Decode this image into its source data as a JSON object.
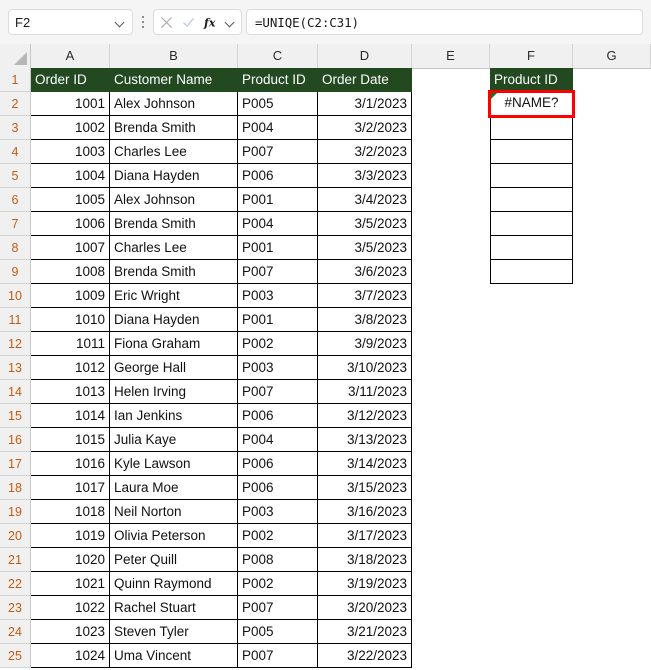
{
  "formula_bar": {
    "name_box_value": "F2",
    "formula_value": "=UNIQE(C2:C31)",
    "cancel_icon": "close-icon",
    "confirm_icon": "check-icon",
    "function_icon": "fx-icon",
    "dropdown_icon": "chevron-down-icon"
  },
  "grid": {
    "column_headers": [
      "A",
      "B",
      "C",
      "D",
      "E",
      "F",
      "G"
    ],
    "row_numbers": [
      1,
      2,
      3,
      4,
      5,
      6,
      7,
      8,
      9,
      10,
      11,
      12,
      13,
      14,
      15,
      16,
      17,
      18,
      19,
      20,
      21,
      22,
      23,
      24,
      25
    ],
    "table_headers": {
      "A1": "Order ID",
      "B1": "Customer Name",
      "C1": "Product ID",
      "D1": "Order Date",
      "F1": "Product ID"
    },
    "rows": [
      {
        "row": 2,
        "order_id": "1001",
        "customer": "Alex Johnson",
        "product_id": "P005",
        "order_date": "3/1/2023"
      },
      {
        "row": 3,
        "order_id": "1002",
        "customer": "Brenda Smith",
        "product_id": "P004",
        "order_date": "3/2/2023"
      },
      {
        "row": 4,
        "order_id": "1003",
        "customer": "Charles Lee",
        "product_id": "P007",
        "order_date": "3/2/2023"
      },
      {
        "row": 5,
        "order_id": "1004",
        "customer": "Diana Hayden",
        "product_id": "P006",
        "order_date": "3/3/2023"
      },
      {
        "row": 6,
        "order_id": "1005",
        "customer": "Alex Johnson",
        "product_id": "P001",
        "order_date": "3/4/2023"
      },
      {
        "row": 7,
        "order_id": "1006",
        "customer": "Brenda Smith",
        "product_id": "P004",
        "order_date": "3/5/2023"
      },
      {
        "row": 8,
        "order_id": "1007",
        "customer": "Charles Lee",
        "product_id": "P001",
        "order_date": "3/5/2023"
      },
      {
        "row": 9,
        "order_id": "1008",
        "customer": "Brenda Smith",
        "product_id": "P007",
        "order_date": "3/6/2023"
      },
      {
        "row": 10,
        "order_id": "1009",
        "customer": "Eric Wright",
        "product_id": "P003",
        "order_date": "3/7/2023"
      },
      {
        "row": 11,
        "order_id": "1010",
        "customer": "Diana Hayden",
        "product_id": "P001",
        "order_date": "3/8/2023"
      },
      {
        "row": 12,
        "order_id": "1011",
        "customer": "Fiona Graham",
        "product_id": "P002",
        "order_date": "3/9/2023"
      },
      {
        "row": 13,
        "order_id": "1012",
        "customer": "George Hall",
        "product_id": "P003",
        "order_date": "3/10/2023"
      },
      {
        "row": 14,
        "order_id": "1013",
        "customer": "Helen Irving",
        "product_id": "P007",
        "order_date": "3/11/2023"
      },
      {
        "row": 15,
        "order_id": "1014",
        "customer": "Ian Jenkins",
        "product_id": "P006",
        "order_date": "3/12/2023"
      },
      {
        "row": 16,
        "order_id": "1015",
        "customer": "Julia Kaye",
        "product_id": "P004",
        "order_date": "3/13/2023"
      },
      {
        "row": 17,
        "order_id": "1016",
        "customer": "Kyle Lawson",
        "product_id": "P006",
        "order_date": "3/14/2023"
      },
      {
        "row": 18,
        "order_id": "1017",
        "customer": "Laura Moe",
        "product_id": "P006",
        "order_date": "3/15/2023"
      },
      {
        "row": 19,
        "order_id": "1018",
        "customer": "Neil Norton",
        "product_id": "P003",
        "order_date": "3/16/2023"
      },
      {
        "row": 20,
        "order_id": "1019",
        "customer": "Olivia Peterson",
        "product_id": "P002",
        "order_date": "3/17/2023"
      },
      {
        "row": 21,
        "order_id": "1020",
        "customer": "Peter Quill",
        "product_id": "P008",
        "order_date": "3/18/2023"
      },
      {
        "row": 22,
        "order_id": "1021",
        "customer": "Quinn Raymond",
        "product_id": "P002",
        "order_date": "3/19/2023"
      },
      {
        "row": 23,
        "order_id": "1022",
        "customer": "Rachel Stuart",
        "product_id": "P007",
        "order_date": "3/20/2023"
      },
      {
        "row": 24,
        "order_id": "1023",
        "customer": "Steven Tyler",
        "product_id": "P005",
        "order_date": "3/21/2023"
      },
      {
        "row": 25,
        "order_id": "1024",
        "customer": "Uma Vincent",
        "product_id": "P007",
        "order_date": "3/22/2023"
      }
    ],
    "output_column": {
      "error_value": "#NAME?",
      "error_indicator": "error-triangle-icon",
      "empty_cell_rows": [
        3,
        4,
        5,
        6,
        7,
        8,
        9
      ]
    }
  },
  "colors": {
    "header_green": "#22491F",
    "selection_red": "#FF0000",
    "row_header_text": "#C25C13",
    "error_indicator_green": "#0A7A27"
  }
}
